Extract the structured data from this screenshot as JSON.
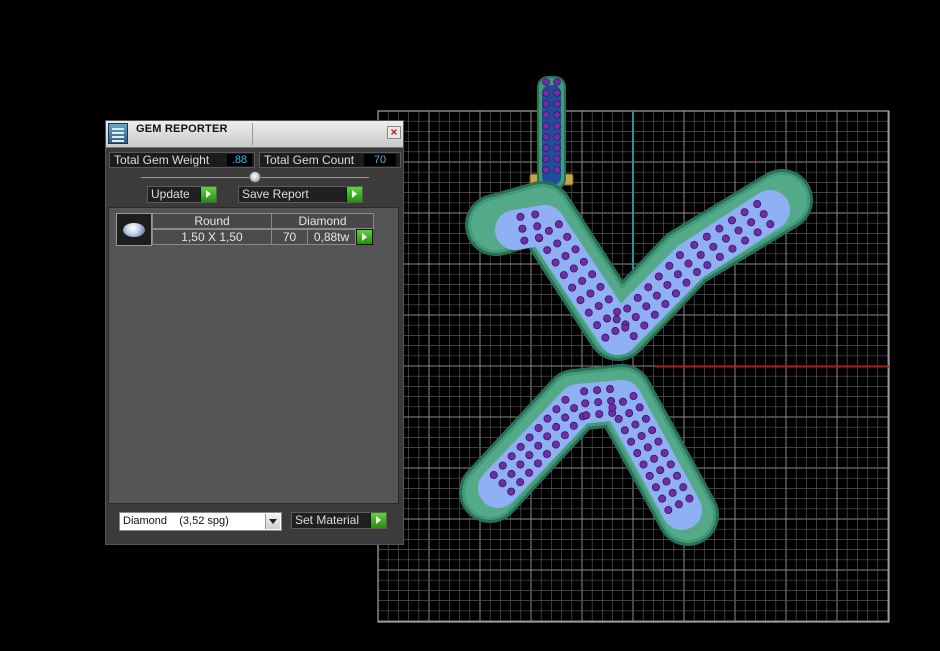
{
  "panel": {
    "title": "GEM REPORTER",
    "close_glyph": "×",
    "total_weight_label": "Total Gem Weight",
    "total_weight_value": ".88",
    "total_count_label": "Total Gem Count",
    "total_count_value": "70",
    "update_label": "Update",
    "save_report_label": "Save Report",
    "table": {
      "headers": [
        "Round",
        "Diamond"
      ],
      "rows": [
        {
          "size": "1,50 X 1,50",
          "count": "70",
          "weight": "0,88tw"
        }
      ]
    },
    "material_select": {
      "value": "Diamond    (3,52 spg)"
    },
    "set_material_label": "Set Material"
  },
  "colors": {
    "background": "#000000",
    "grid_line": "#6e6e6e",
    "grid_border": "#9a9a9a",
    "axis_x": "#b01e1e",
    "axis_y": "#2c8fa3",
    "metal": "#3f9b78",
    "metal_edge": "#2a6f57",
    "gem_bed": "#8fb0f2",
    "gem": "#6d2fa6",
    "accent_blue": "#49b7e8",
    "button_green": "#46b52a"
  },
  "icons": {
    "title": "gem-reporter-icon",
    "close": "close-icon",
    "go": "play-arrow-icon",
    "dropdown": "chevron-down-icon"
  }
}
